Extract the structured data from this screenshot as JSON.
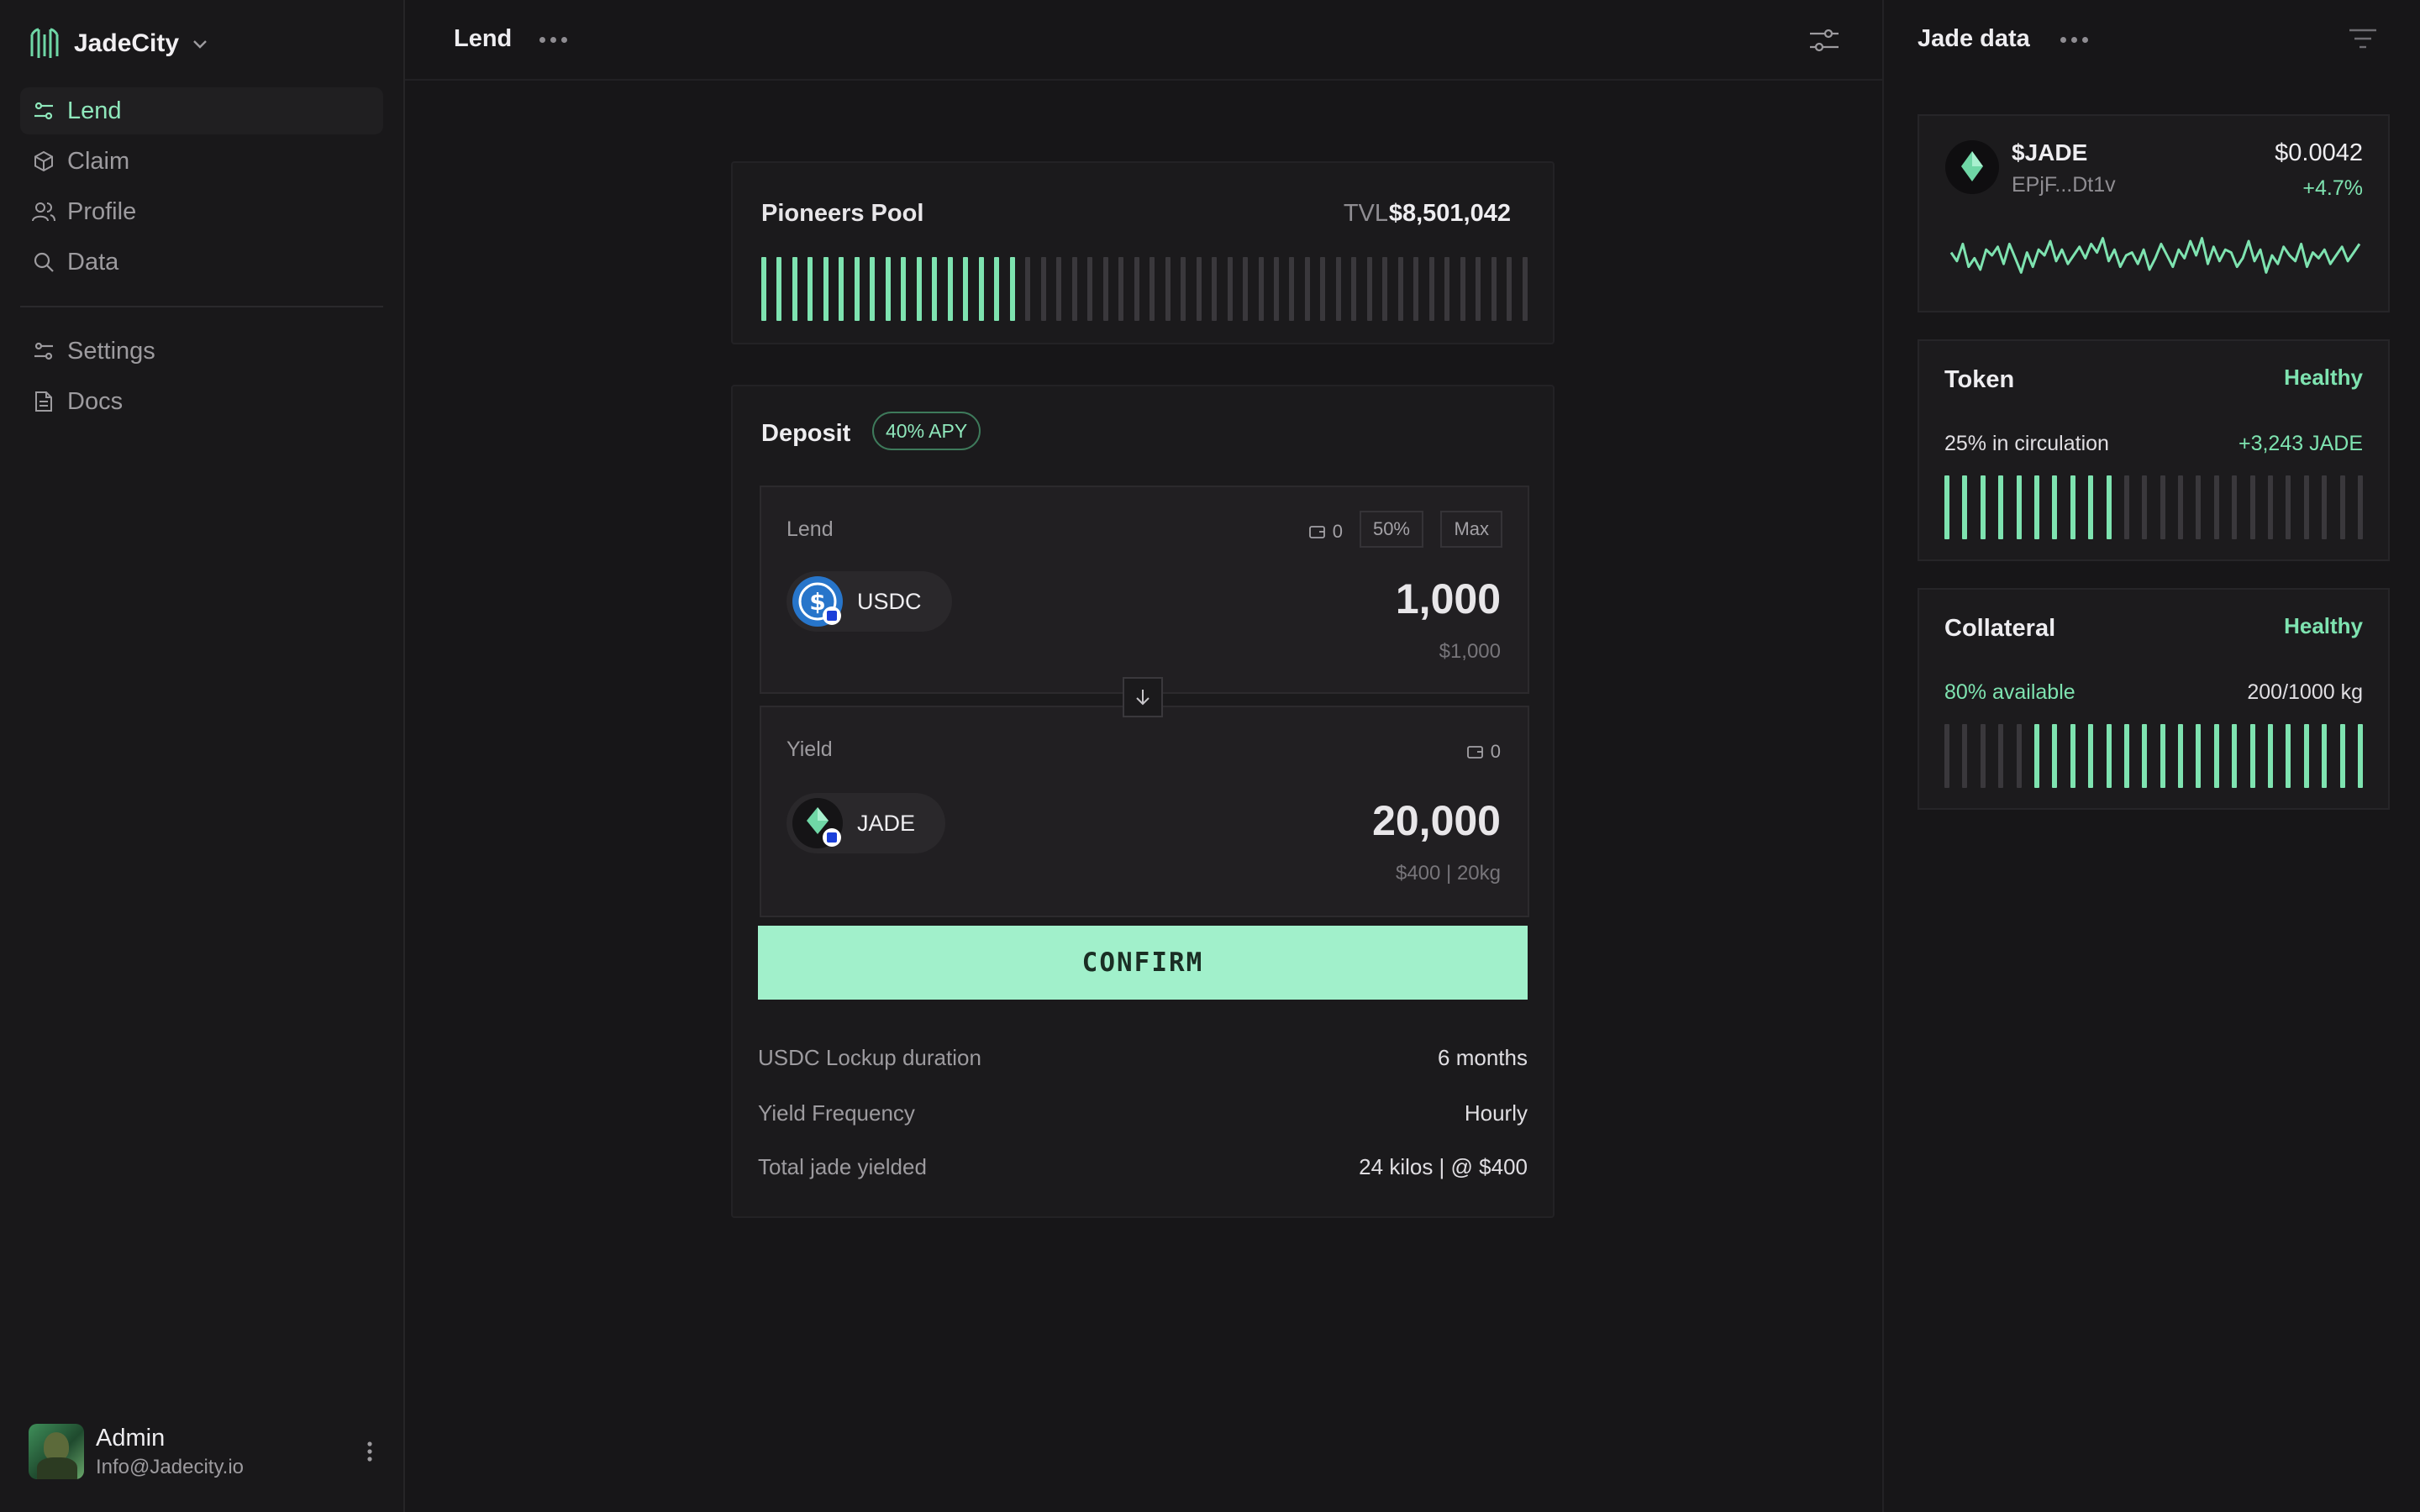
{
  "brand": {
    "name": "JadeCity"
  },
  "sidebar": {
    "items": [
      {
        "label": "Lend",
        "icon": "sliders-icon",
        "active": true
      },
      {
        "label": "Claim",
        "icon": "box-icon"
      },
      {
        "label": "Profile",
        "icon": "users-icon"
      },
      {
        "label": "Data",
        "icon": "search-icon"
      }
    ],
    "secondary": [
      {
        "label": "Settings",
        "icon": "sliders-icon"
      },
      {
        "label": "Docs",
        "icon": "document-icon"
      }
    ]
  },
  "user": {
    "name": "Admin",
    "email": "Info@Jadecity.io"
  },
  "main": {
    "title": "Lend",
    "pool": {
      "title": "Pioneers Pool",
      "tvl_label": "TVL",
      "tvl_value": "$8,501,042",
      "bar_count": 50,
      "fill_fraction": 0.34
    },
    "deposit": {
      "title": "Deposit",
      "apy": "40% APY",
      "lend": {
        "label": "Lend",
        "wallet_balance": "0",
        "half_label": "50%",
        "max_label": "Max",
        "token": "USDC",
        "amount": "1,000",
        "usd_value": "$1,000"
      },
      "yield": {
        "label": "Yield",
        "wallet_balance": "0",
        "token": "JADE",
        "amount": "20,000",
        "usd_value": "$400 | 20kg"
      },
      "confirm_label": "CONFIRM",
      "info": [
        {
          "key": "USDC Lockup duration",
          "value": "6 months"
        },
        {
          "key": "Yield Frequency",
          "value": "Hourly"
        },
        {
          "key": "Total jade yielded",
          "value": "24 kilos | @ $400"
        }
      ]
    }
  },
  "right_panel": {
    "title": "Jade data",
    "ticker": {
      "symbol": "$JADE",
      "address": "EPjF...Dt1v",
      "price": "$0.0042",
      "change": "+4.7%",
      "sparkline": [
        0.55,
        0.4,
        0.7,
        0.3,
        0.45,
        0.25,
        0.6,
        0.5,
        0.65,
        0.35,
        0.7,
        0.45,
        0.2,
        0.55,
        0.3,
        0.6,
        0.5,
        0.75,
        0.4,
        0.6,
        0.35,
        0.5,
        0.65,
        0.45,
        0.7,
        0.55,
        0.8,
        0.4,
        0.6,
        0.3,
        0.5,
        0.55,
        0.35,
        0.6,
        0.25,
        0.45,
        0.7,
        0.5,
        0.3,
        0.6,
        0.45,
        0.75,
        0.5,
        0.8,
        0.35,
        0.65,
        0.4,
        0.6,
        0.55,
        0.3,
        0.45,
        0.75,
        0.4,
        0.6,
        0.2,
        0.5,
        0.35,
        0.65,
        0.5,
        0.4,
        0.7,
        0.3,
        0.55,
        0.45,
        0.6,
        0.35,
        0.5,
        0.65,
        0.4,
        0.55,
        0.7
      ]
    },
    "token": {
      "title": "Token",
      "status": "Healthy",
      "circulation": "25% in circulation",
      "delta": "+3,243 JADE",
      "bar_count": 24,
      "fill_fraction": 0.42
    },
    "collateral": {
      "title": "Collateral",
      "status": "Healthy",
      "available": "80% available",
      "capacity": "200/1000 kg",
      "bar_count": 24,
      "empty_fraction": 0.21
    }
  },
  "colors": {
    "accent": "#8fe8bc",
    "bar_fill": "#7ee3b0",
    "bar_empty": "#3a383c",
    "confirm_bg": "#a1f0cb",
    "usdc_blue": "#2775ca"
  }
}
